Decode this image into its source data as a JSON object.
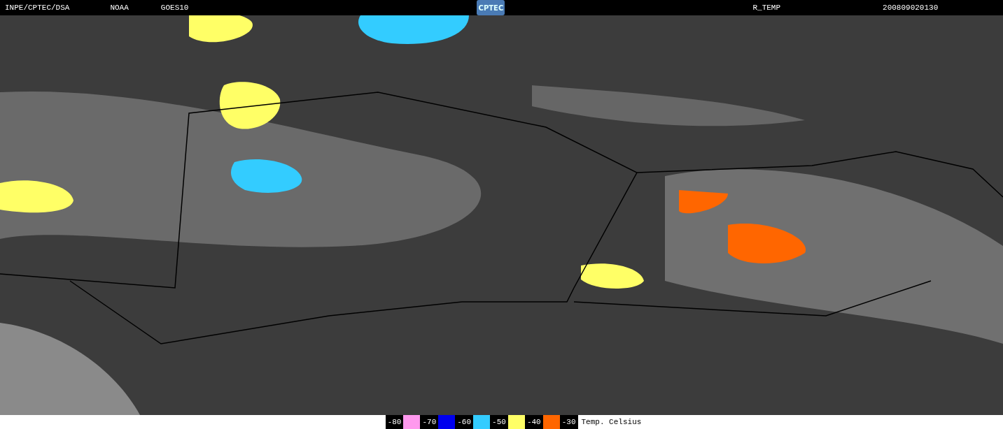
{
  "header": {
    "source": "INPE/CPTEC/DSA",
    "agency": "NOAA",
    "satellite": "GOES10",
    "logo": "CPTEC",
    "product": "R_TEMP",
    "timestamp": "200809020130"
  },
  "legend": {
    "items": [
      {
        "label": "-80",
        "color": "#ff99ee"
      },
      {
        "label": "-70",
        "color": "#0000ee"
      },
      {
        "label": "-60",
        "color": "#33ccff"
      },
      {
        "label": "-50",
        "color": "#ffff66"
      },
      {
        "label": "-40",
        "color": "#ff6600"
      },
      {
        "label": "-30"
      }
    ],
    "unit": "Temp. Celsius"
  }
}
